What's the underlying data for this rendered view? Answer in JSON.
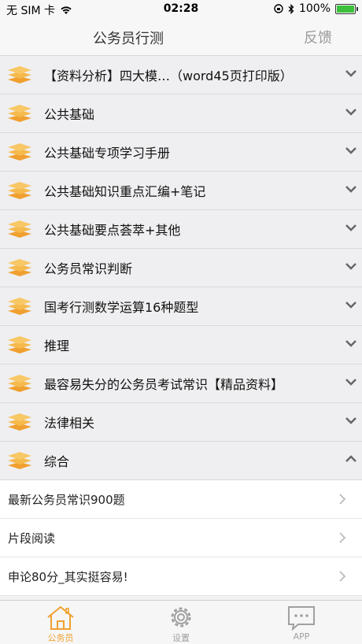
{
  "status_bar": {
    "carrier": "无 SIM 卡",
    "time": "02:28",
    "battery": "100%"
  },
  "header": {
    "title": "公务员行测",
    "feedback": "反馈"
  },
  "categories": [
    {
      "label": "【资料分析】四大模…（word45页打印版）",
      "expanded": false
    },
    {
      "label": "公共基础",
      "expanded": false
    },
    {
      "label": "公共基础专项学习手册",
      "expanded": false
    },
    {
      "label": "公共基础知识重点汇编+笔记",
      "expanded": false
    },
    {
      "label": "公共基础要点荟萃+其他",
      "expanded": false
    },
    {
      "label": "公务员常识判断",
      "expanded": false
    },
    {
      "label": "国考行测数学运算16种题型",
      "expanded": false
    },
    {
      "label": "推理",
      "expanded": false
    },
    {
      "label": "最容易失分的公务员考试常识【精品资料】",
      "expanded": false
    },
    {
      "label": "法律相关",
      "expanded": false
    },
    {
      "label": "综合",
      "expanded": true
    }
  ],
  "expanded_items": [
    {
      "label": "最新公务员常识900题"
    },
    {
      "label": "片段阅读"
    },
    {
      "label": "申论80分_其实挺容易!"
    }
  ],
  "tabbar": {
    "tabs": [
      {
        "label": "公务员",
        "icon": "house-icon",
        "active": true
      },
      {
        "label": "设置",
        "icon": "gear-icon",
        "active": false
      },
      {
        "label": "APP",
        "icon": "chat-icon",
        "active": false
      }
    ]
  },
  "colors": {
    "accent": "#f0a030",
    "inactive": "#a0a0a0",
    "category_bg": "#efeff1"
  }
}
